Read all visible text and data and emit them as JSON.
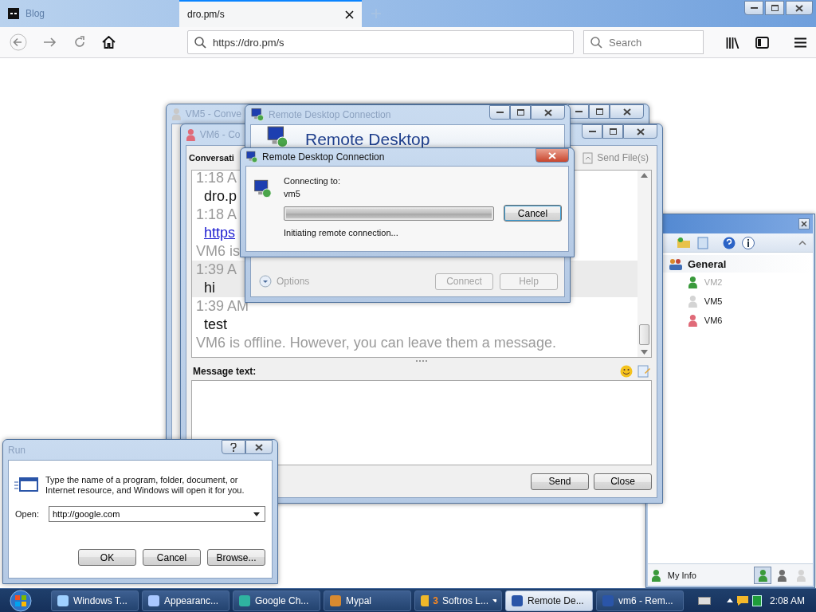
{
  "browser": {
    "tabs": [
      {
        "label": "Blog",
        "selected": false
      },
      {
        "label": "dro.pm/s",
        "selected": true
      }
    ],
    "url": "https://dro.pm/s",
    "search": {
      "placeholder": "Search"
    }
  },
  "windows": {
    "vm5_conversation": {
      "title": "VM5 - Conve"
    },
    "vm6_conversation": {
      "title": "VM6 - Co",
      "section": "Conversati",
      "send_files": "Send File(s)",
      "messages": [
        {
          "kind": "time",
          "text": "1:18 A",
          "highlighted": false
        },
        {
          "kind": "message",
          "text": "dro.p",
          "highlighted": false
        },
        {
          "kind": "time",
          "text": "1:18 A",
          "highlighted": false
        },
        {
          "kind": "link",
          "text": "https",
          "highlighted": false
        },
        {
          "kind": "notice",
          "text": "VM6 is",
          "highlighted": false
        },
        {
          "kind": "time",
          "text": "1:39 A",
          "highlighted": true
        },
        {
          "kind": "message",
          "text": "hi",
          "highlighted": true
        },
        {
          "kind": "time",
          "text": "1:39 AM",
          "highlighted": false
        },
        {
          "kind": "message",
          "text": "test",
          "highlighted": false
        },
        {
          "kind": "notice",
          "text": "VM6 is offline. However, you can leave them a message.",
          "highlighted": false
        }
      ],
      "message_label": "Message text:",
      "buttons": [
        "Send",
        "Close"
      ]
    },
    "rdc_main": {
      "title": "Remote Desktop Connection",
      "heading": "Remote Desktop",
      "options": "Options",
      "buttons": [
        {
          "label": "Connect",
          "disabled": true
        },
        {
          "label": "Help",
          "disabled": true
        }
      ]
    },
    "rdc_dialog": {
      "title": "Remote Desktop Connection",
      "connecting_label": "Connecting to:",
      "host": "vm5",
      "progress": {
        "level": 1
      },
      "cancel": "Cancel",
      "status": "Initiating remote connection..."
    },
    "messenger": {
      "group": "General",
      "contacts": [
        {
          "name": "VM2",
          "dimmed": true,
          "color": "#3a9a3c"
        },
        {
          "name": "VM5",
          "dimmed": false,
          "color": "#d4d4d4"
        },
        {
          "name": "VM6",
          "dimmed": false,
          "color": "#e06a78"
        }
      ],
      "my_info": "My Info",
      "status_buttons": [
        {
          "selected": true,
          "color": "#3a9a3c"
        },
        {
          "selected": false,
          "color": "#6e6e6e"
        },
        {
          "selected": false,
          "color": "#d4d4d4"
        }
      ]
    },
    "run": {
      "title": "Run",
      "description": [
        "Type the name of a program, folder, document, or",
        "Internet resource, and Windows will open it for you."
      ],
      "open_label": "Open:",
      "value": "http://google.com",
      "buttons": [
        "OK",
        "Cancel",
        "Browse..."
      ]
    }
  },
  "taskbar": {
    "items": [
      {
        "label": "Windows T...",
        "selected": false,
        "grouped": false
      },
      {
        "label": "Appearanc...",
        "selected": false,
        "grouped": false
      },
      {
        "label": "Google Ch...",
        "selected": false,
        "grouped": false
      },
      {
        "label": "Mypal",
        "selected": false,
        "grouped": false
      },
      {
        "label": "Softros L...",
        "count": "3",
        "selected": false,
        "grouped": true
      },
      {
        "label": "Remote De...",
        "selected": true,
        "grouped": false
      },
      {
        "label": "vm6 - Rem...",
        "selected": false,
        "grouped": false
      }
    ],
    "clock": "2:08 AM"
  }
}
